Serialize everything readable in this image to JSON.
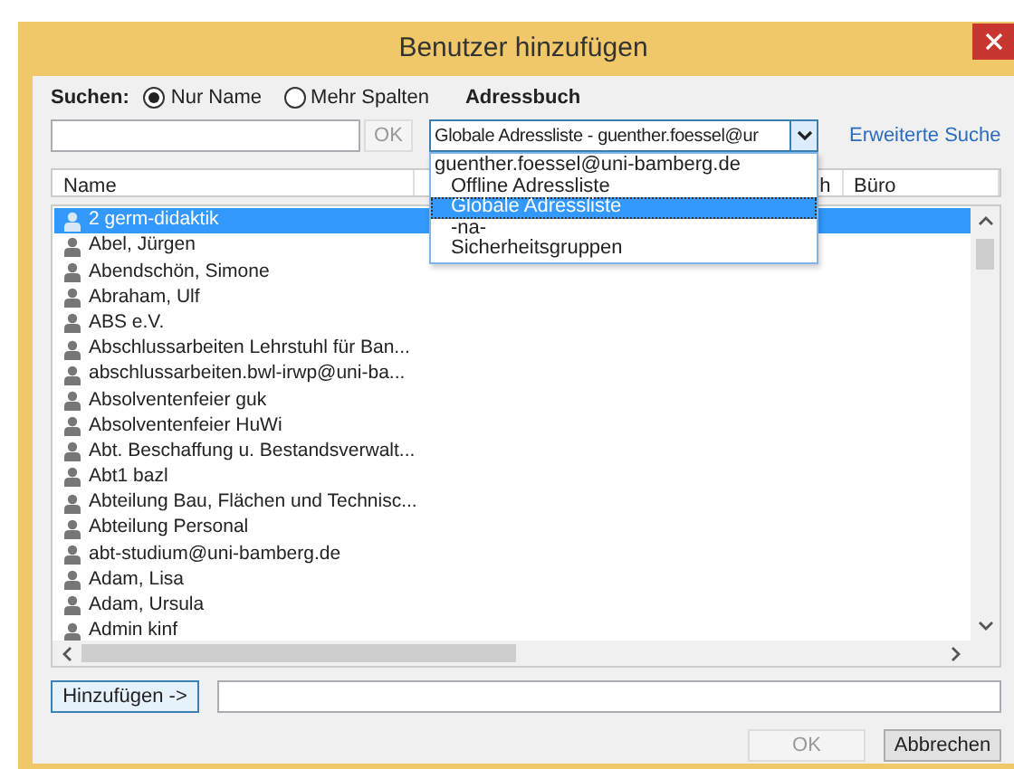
{
  "window": {
    "title": "Benutzer hinzufügen"
  },
  "search": {
    "label": "Suchen:",
    "options": [
      {
        "label": "Nur Name",
        "selected": true
      },
      {
        "label": "Mehr Spalten",
        "selected": false
      }
    ],
    "ok_button": {
      "label": "OK",
      "disabled": true
    }
  },
  "address_book": {
    "label": "Adressbuch",
    "value": "Globale Adressliste - guenther.foessel@ur",
    "options": [
      {
        "label": "guenther.foessel@uni-bamberg.de",
        "selected": false,
        "children": [
          {
            "label": "Offline Adressliste",
            "selected": false
          },
          {
            "label": "Globale Adressliste",
            "selected": true
          },
          {
            "label": "-na-",
            "selected": false
          },
          {
            "label": "Sicherheitsgruppen",
            "selected": false
          }
        ]
      }
    ]
  },
  "advanced_search_link": "Erweiterte Suche",
  "table": {
    "columns": [
      "Name",
      "h",
      "Büro"
    ],
    "rows": [
      {
        "name": "2 germ-didaktik",
        "selected": true
      },
      {
        "name": "Abel, Jürgen",
        "selected": false
      },
      {
        "name": "Abendschön, Simone",
        "selected": false
      },
      {
        "name": "Abraham, Ulf",
        "selected": false
      },
      {
        "name": "ABS e.V.",
        "selected": false
      },
      {
        "name": "Abschlussarbeiten Lehrstuhl für Ban...",
        "selected": false
      },
      {
        "name": "abschlussarbeiten.bwl-irwp@uni-ba...",
        "selected": false
      },
      {
        "name": "Absolventenfeier guk",
        "selected": false
      },
      {
        "name": "Absolventenfeier HuWi",
        "selected": false
      },
      {
        "name": "Abt. Beschaffung u. Bestandsverwalt...",
        "selected": false
      },
      {
        "name": "Abt1 bazl",
        "selected": false
      },
      {
        "name": "Abteilung Bau, Flächen und Technisc...",
        "selected": false
      },
      {
        "name": "Abteilung Personal",
        "selected": false
      },
      {
        "name": "abt-studium@uni-bamberg.de",
        "selected": false
      },
      {
        "name": "Adam, Lisa",
        "selected": false
      },
      {
        "name": "Adam, Ursula",
        "selected": false
      },
      {
        "name": "Admin kinf",
        "selected": false
      }
    ]
  },
  "add_button": {
    "label": "Hinzufügen ->"
  },
  "buttons": [
    {
      "label": "OK",
      "disabled": true
    },
    {
      "label": "Abbrechen",
      "disabled": false
    }
  ]
}
